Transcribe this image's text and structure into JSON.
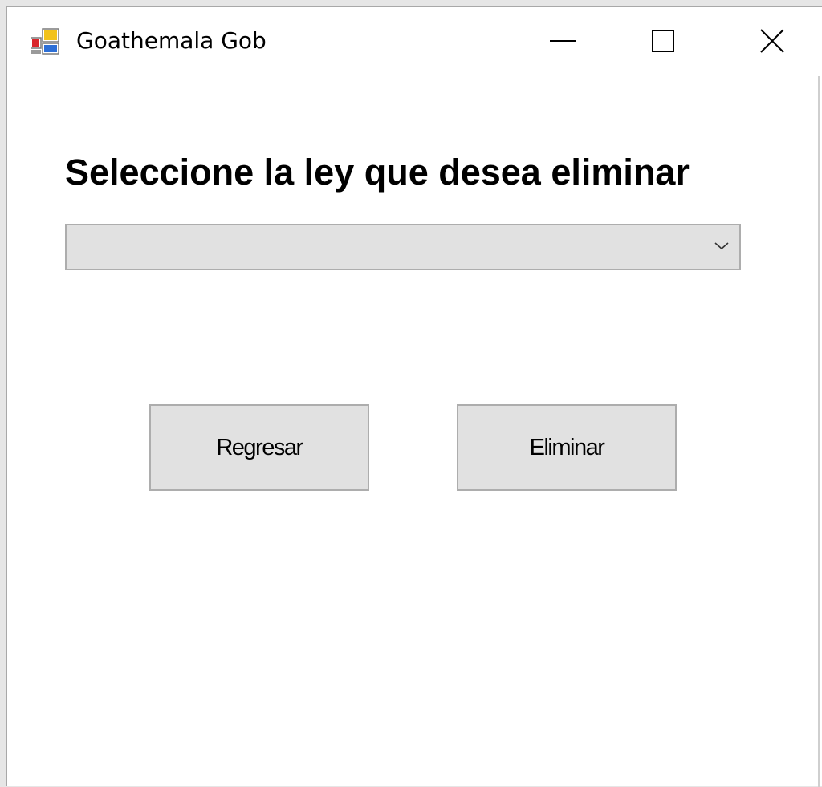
{
  "window": {
    "title": "Goathemala Gob",
    "icons": {
      "app": "app-window-icon",
      "minimize": "minimize-icon",
      "maximize": "maximize-icon",
      "close": "close-icon"
    }
  },
  "main": {
    "heading": "Seleccione la ley que desea eliminar",
    "law_select": {
      "value": "",
      "arrow_icon": "chevron-down-icon"
    },
    "buttons": {
      "back_label": "Regresar",
      "delete_label": "Eliminar"
    }
  }
}
